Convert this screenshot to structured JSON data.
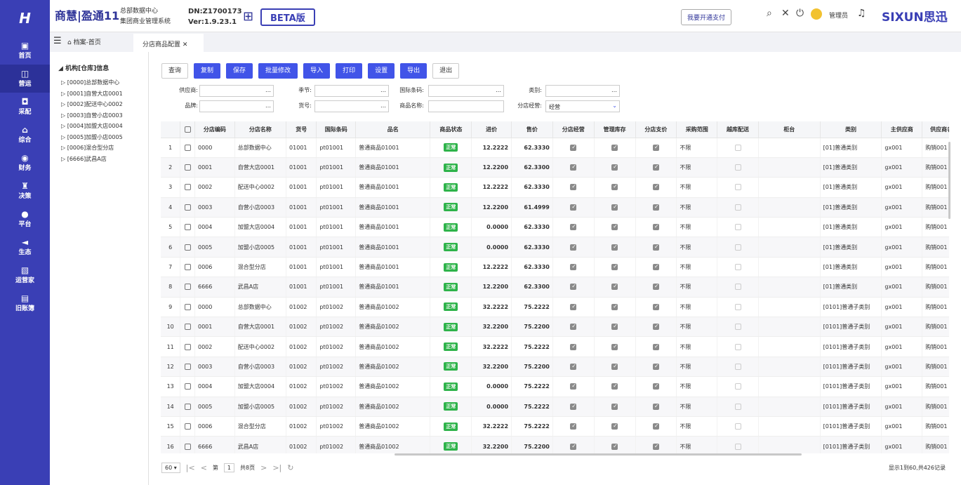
{
  "nav": {
    "logo": "H",
    "items": [
      {
        "icon": "▣",
        "label": "首页"
      },
      {
        "icon": "◫",
        "label": "营运"
      },
      {
        "icon": "◘",
        "label": "采配"
      },
      {
        "icon": "⌂",
        "label": "综合"
      },
      {
        "icon": "◉",
        "label": "财务"
      },
      {
        "icon": "♜",
        "label": "决策"
      },
      {
        "icon": "●",
        "label": "平台"
      },
      {
        "icon": "◄",
        "label": "生态"
      },
      {
        "icon": "▧",
        "label": "运营家"
      },
      {
        "icon": "▤",
        "label": "旧账簿"
      }
    ]
  },
  "header": {
    "brand": "商慧|盈通11",
    "sub1": "总部数据中心",
    "sub2": "集团商业管理系统",
    "dn": "DN:Z1700173",
    "version": "Ver:1.9.23.1",
    "beta": "BETA版",
    "pay_button": "我要开通支付",
    "admin": "管理员",
    "logo_text": "SIXUN思迅"
  },
  "tabs": {
    "home": "档案-首页",
    "active": "分店商品配置"
  },
  "tree": {
    "root": "机构[仓库]信息",
    "nodes": [
      "[0000]总部数据中心",
      "[0001]自营大店0001",
      "[0002]配送中心0002",
      "[0003]自营小店0003",
      "[0004]加盟大店0004",
      "[0005]加盟小店0005",
      "[0006]混合型分店",
      "[6666]武昌A店"
    ]
  },
  "toolbar": [
    "查询",
    "复制",
    "保存",
    "批量修改",
    "导入",
    "打印",
    "设置",
    "导出",
    "退出"
  ],
  "filters": {
    "supplier": "供应商:",
    "season": "季节:",
    "barcode": "国际条码:",
    "category": "类别:",
    "brand": "品牌:",
    "item_no": "货号:",
    "item_name": "商品名称:",
    "operate": "分店经营:",
    "operate_value": "经营"
  },
  "table": {
    "columns": [
      "",
      "分店编码",
      "分店名称",
      "货号",
      "国际条码",
      "品名",
      "商品状态",
      "进价",
      "售价",
      "分店经营",
      "管理库存",
      "分店支价",
      "采购范围",
      "越库配送",
      "柜台",
      "类别",
      "主供应商",
      "供应商名"
    ],
    "rows": [
      [
        "1",
        "0000",
        "总部数据中心",
        "01001",
        "pt01001",
        "普通商品01001",
        "正常",
        "12.2222",
        "62.3330",
        "不限",
        "[01]普通类别",
        "gx001",
        "购销001"
      ],
      [
        "2",
        "0001",
        "自营大店0001",
        "01001",
        "pt01001",
        "普通商品01001",
        "正常",
        "12.2200",
        "62.3300",
        "不限",
        "[01]普通类别",
        "gx001",
        "购销001"
      ],
      [
        "3",
        "0002",
        "配送中心0002",
        "01001",
        "pt01001",
        "普通商品01001",
        "正常",
        "12.2222",
        "62.3330",
        "不限",
        "[01]普通类别",
        "gx001",
        "购销001"
      ],
      [
        "4",
        "0003",
        "自营小店0003",
        "01001",
        "pt01001",
        "普通商品01001",
        "正常",
        "12.2200",
        "61.4999",
        "不限",
        "[01]普通类别",
        "gx001",
        "购销001"
      ],
      [
        "5",
        "0004",
        "加盟大店0004",
        "01001",
        "pt01001",
        "普通商品01001",
        "正常",
        "0.0000",
        "62.3330",
        "不限",
        "[01]普通类别",
        "gx001",
        "购销001"
      ],
      [
        "6",
        "0005",
        "加盟小店0005",
        "01001",
        "pt01001",
        "普通商品01001",
        "正常",
        "0.0000",
        "62.3330",
        "不限",
        "[01]普通类别",
        "gx001",
        "购销001"
      ],
      [
        "7",
        "0006",
        "混合型分店",
        "01001",
        "pt01001",
        "普通商品01001",
        "正常",
        "12.2222",
        "62.3330",
        "不限",
        "[01]普通类别",
        "gx001",
        "购销001"
      ],
      [
        "8",
        "6666",
        "武昌A店",
        "01001",
        "pt01001",
        "普通商品01001",
        "正常",
        "12.2200",
        "62.3300",
        "不限",
        "[01]普通类别",
        "gx001",
        "购销001"
      ],
      [
        "9",
        "0000",
        "总部数据中心",
        "01002",
        "pt01002",
        "普通商品01002",
        "正常",
        "32.2222",
        "75.2222",
        "不限",
        "[0101]普通子类别",
        "gx001",
        "购销001"
      ],
      [
        "10",
        "0001",
        "自营大店0001",
        "01002",
        "pt01002",
        "普通商品01002",
        "正常",
        "32.2200",
        "75.2200",
        "不限",
        "[0101]普通子类别",
        "gx001",
        "购销001"
      ],
      [
        "11",
        "0002",
        "配送中心0002",
        "01002",
        "pt01002",
        "普通商品01002",
        "正常",
        "32.2222",
        "75.2222",
        "不限",
        "[0101]普通子类别",
        "gx001",
        "购销001"
      ],
      [
        "12",
        "0003",
        "自营小店0003",
        "01002",
        "pt01002",
        "普通商品01002",
        "正常",
        "32.2200",
        "75.2200",
        "不限",
        "[0101]普通子类别",
        "gx001",
        "购销001"
      ],
      [
        "13",
        "0004",
        "加盟大店0004",
        "01002",
        "pt01002",
        "普通商品01002",
        "正常",
        "0.0000",
        "75.2222",
        "不限",
        "[0101]普通子类别",
        "gx001",
        "购销001"
      ],
      [
        "14",
        "0005",
        "加盟小店0005",
        "01002",
        "pt01002",
        "普通商品01002",
        "正常",
        "0.0000",
        "75.2222",
        "不限",
        "[0101]普通子类别",
        "gx001",
        "购销001"
      ],
      [
        "15",
        "0006",
        "混合型分店",
        "01002",
        "pt01002",
        "普通商品01002",
        "正常",
        "32.2222",
        "75.2222",
        "不限",
        "[0101]普通子类别",
        "gx001",
        "购销001"
      ],
      [
        "16",
        "6666",
        "武昌A店",
        "01002",
        "pt01002",
        "普通商品01002",
        "正常",
        "32.2200",
        "75.2200",
        "不限",
        "[0101]普通子类别",
        "gx001",
        "购销001"
      ]
    ]
  },
  "pager": {
    "page_size": "60",
    "page_prefix": "第",
    "page": "1",
    "total_pages": "共8页",
    "summary": "显示1到60,共426记录"
  },
  "colors": {
    "nav": "#3a3fb5",
    "primary_button": "#4154e8",
    "status_badge": "#2eb34a"
  }
}
